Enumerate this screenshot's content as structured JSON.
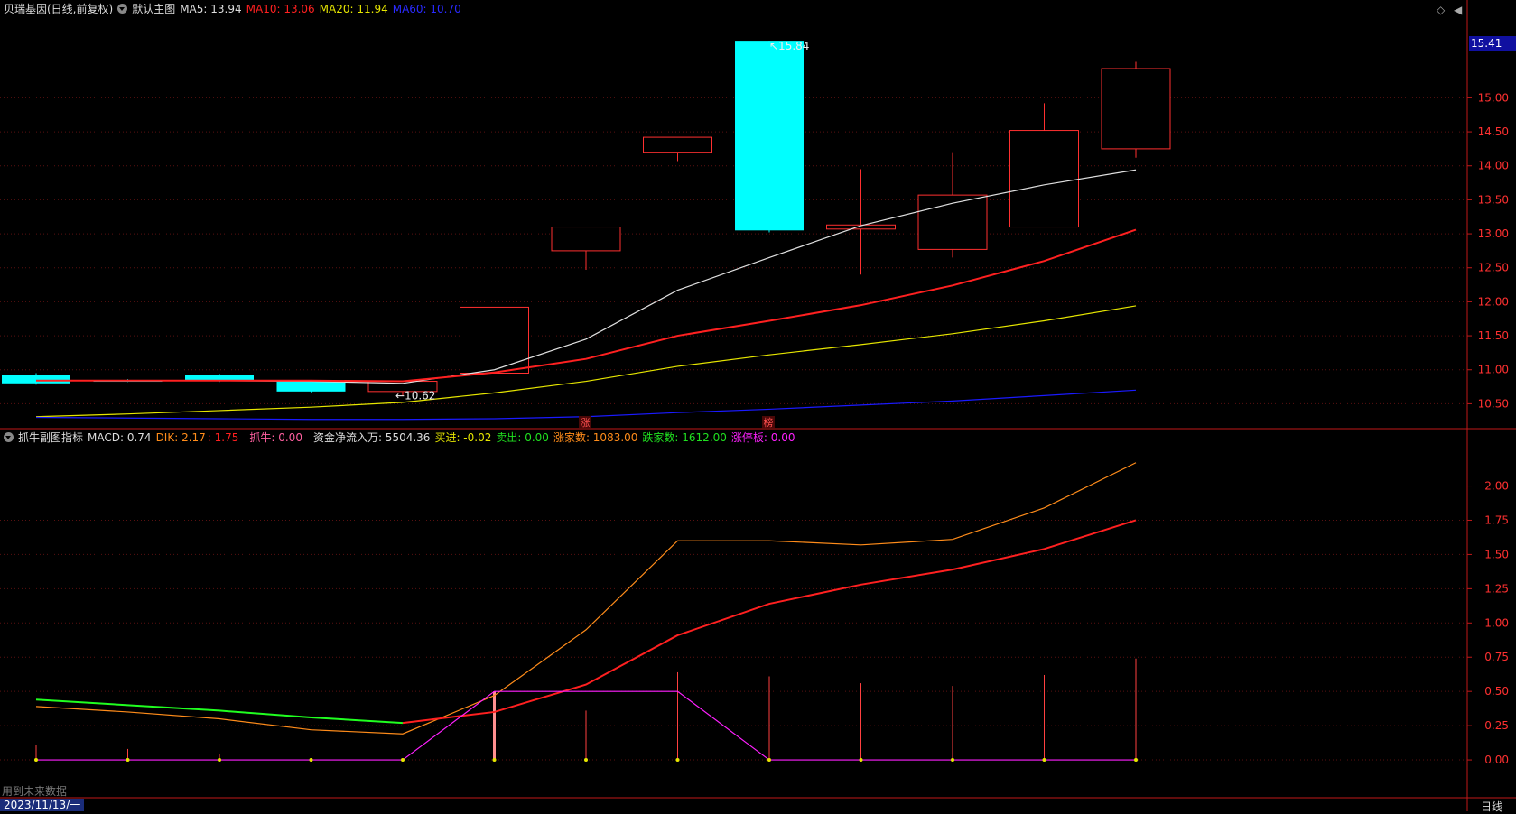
{
  "main_header": {
    "title": "贝瑞基因(日线,前复权)",
    "template": "默认主图",
    "ma5": "MA5: 13.94",
    "ma10": "MA10: 13.06",
    "ma20": "MA20: 11.94",
    "ma60": "MA60: 10.70"
  },
  "sub_header": {
    "title": "抓牛副图指标",
    "macd": "MACD: 0.74",
    "dik": "DIK: 2.17",
    "dik2": ": 1.75",
    "zhuaniu": "抓牛: 0.00",
    "net_inflow": "资金净流入万: 5504.36",
    "buy": "买进: -0.02",
    "sell": "卖出: 0.00",
    "up_count": "涨家数: 1083.00",
    "down_count": "跌家数: 1612.00",
    "limit_up": "涨停板: 0.00"
  },
  "annotations": {
    "high": "15.84",
    "low": "10.62",
    "tag_rise": "涨",
    "tag_list": "榜"
  },
  "current_price": "15.41",
  "footer": {
    "future_data": "用到未来数据",
    "date": "2023/11/13/一",
    "period": "日线"
  },
  "colors": {
    "up": "#ff3030",
    "down": "#00ffff",
    "ma5": "#e0e0e0",
    "ma10": "#ff2020",
    "ma20": "#e6e600",
    "ma60": "#1a1aff"
  },
  "chart_data": [
    {
      "type": "candlestick",
      "ylim": [
        10.2,
        16.2
      ],
      "y_ticks": [
        10.5,
        11.0,
        11.5,
        12.0,
        12.5,
        13.0,
        13.5,
        14.0,
        14.5,
        15.0
      ],
      "candles": [
        {
          "open": 10.92,
          "close": 10.8,
          "high": 10.95,
          "low": 10.78
        },
        {
          "open": 10.85,
          "close": 10.83,
          "high": 10.86,
          "low": 10.82
        },
        {
          "open": 10.92,
          "close": 10.84,
          "high": 10.94,
          "low": 10.82
        },
        {
          "open": 10.83,
          "close": 10.68,
          "high": 10.85,
          "low": 10.67
        },
        {
          "open": 10.68,
          "close": 10.83,
          "high": 10.84,
          "low": 10.62
        },
        {
          "open": 10.95,
          "close": 11.92,
          "high": 11.92,
          "low": 10.95
        },
        {
          "open": 12.75,
          "close": 13.1,
          "high": 13.1,
          "low": 12.47
        },
        {
          "open": 14.2,
          "close": 14.42,
          "high": 14.42,
          "low": 14.07
        },
        {
          "open": 15.84,
          "close": 13.05,
          "high": 15.84,
          "low": 13.02
        },
        {
          "open": 13.07,
          "close": 13.13,
          "high": 13.95,
          "low": 12.4
        },
        {
          "open": 12.77,
          "close": 13.57,
          "high": 14.2,
          "low": 12.65
        },
        {
          "open": 13.1,
          "close": 14.52,
          "high": 14.92,
          "low": 13.1
        },
        {
          "open": 14.25,
          "close": 15.43,
          "high": 15.53,
          "low": 14.12
        }
      ],
      "ma": {
        "MA5": [
          10.84,
          10.84,
          10.84,
          10.83,
          10.8,
          11.0,
          11.45,
          12.17,
          12.65,
          13.12,
          13.45,
          13.72,
          13.94
        ],
        "MA10": [
          10.84,
          10.84,
          10.84,
          10.84,
          10.83,
          10.96,
          11.16,
          11.5,
          11.72,
          11.95,
          12.24,
          12.6,
          13.06
        ],
        "MA20": [
          10.31,
          10.35,
          10.4,
          10.45,
          10.52,
          10.66,
          10.83,
          11.05,
          11.22,
          11.37,
          11.53,
          11.72,
          11.94
        ],
        "MA60": [
          10.3,
          10.29,
          10.28,
          10.27,
          10.27,
          10.28,
          10.31,
          10.37,
          10.42,
          10.48,
          10.54,
          10.62,
          10.7
        ]
      }
    },
    {
      "type": "line",
      "title": "抓牛副图指标",
      "ylim": [
        -0.25,
        2.3
      ],
      "y_ticks": [
        0.0,
        0.25,
        0.5,
        0.75,
        1.0,
        1.25,
        1.5,
        1.75,
        2.0
      ],
      "series": [
        {
          "name": "DIK",
          "color": "#ff8c1a",
          "values": [
            0.39,
            0.35,
            0.3,
            0.22,
            0.19,
            0.47,
            0.95,
            1.6,
            1.6,
            1.57,
            1.61,
            1.84,
            2.17
          ]
        },
        {
          "name": "DEA",
          "color": "#ff2020",
          "values": [
            0.44,
            0.4,
            0.36,
            0.31,
            0.27,
            0.35,
            0.55,
            0.91,
            1.14,
            1.28,
            1.39,
            1.54,
            1.75
          ],
          "color_early": "#20ff20",
          "early_count": 5
        },
        {
          "name": "抓牛",
          "color": "#ff20ff",
          "values": [
            0,
            0,
            0,
            0,
            0,
            0.5,
            0.5,
            0.5,
            0,
            0,
            0,
            0,
            0
          ]
        }
      ],
      "bars": {
        "name": "MACD",
        "values": [
          0.11,
          0.08,
          0.04,
          0.01,
          0.01,
          0.5,
          0.36,
          0.64,
          0.61,
          0.56,
          0.54,
          0.62,
          0.74
        ]
      }
    }
  ]
}
